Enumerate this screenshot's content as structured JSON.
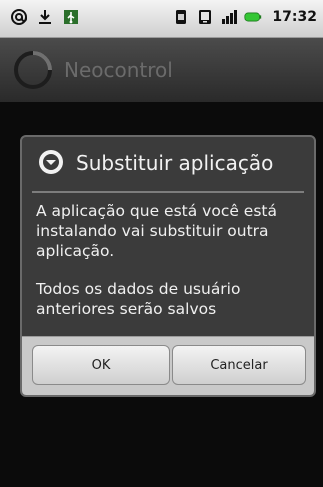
{
  "status_bar": {
    "time": "17:32",
    "icons_left": [
      "at-icon",
      "download-icon",
      "usb-icon"
    ],
    "icons_right": [
      "sim-icon",
      "phone-icon",
      "signal-icon",
      "battery-icon"
    ]
  },
  "app": {
    "title": "Neocontrol",
    "icon": "spinner-icon"
  },
  "dialog": {
    "icon": "arrow-down-circle-icon",
    "title": "Substituir aplicação",
    "message1": "A aplicação que está você está instalando vai substituir outra aplicação.",
    "message2": "Todos os dados de usuário anteriores serão salvos",
    "ok_label": "OK",
    "cancel_label": "Cancelar"
  },
  "colors": {
    "status_bar_bg": "#e2e2e2",
    "title_bar_bg": "#3a3a3a",
    "dialog_bg": "#3b3b3b",
    "button_bar_bg": "#c9c9c9",
    "battery_green": "#34c634"
  }
}
